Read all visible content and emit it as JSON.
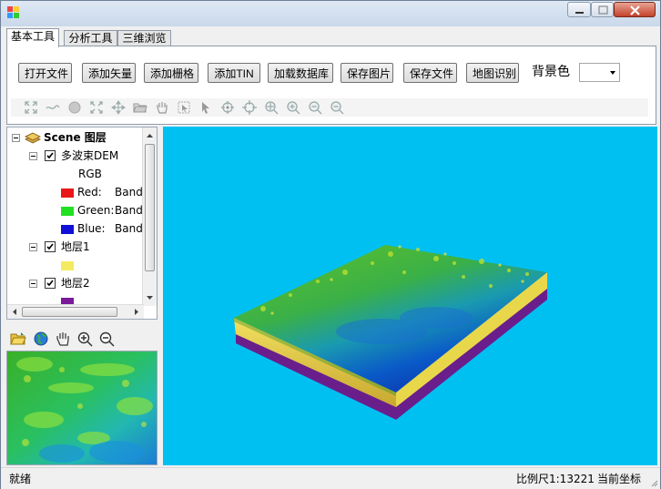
{
  "window": {
    "title": ""
  },
  "tabs": [
    {
      "label": "基本工具",
      "active": true
    },
    {
      "label": "分析工具",
      "active": false
    },
    {
      "label": "三维浏览",
      "active": false
    }
  ],
  "toolbar": {
    "buttons": [
      "打开文件",
      "添加矢量",
      "添加栅格",
      "添加TIN",
      "加载数据库",
      "保存图片",
      "保存文件",
      "地图识别"
    ],
    "background_label": "背景色",
    "background_value": ""
  },
  "map_tools": [
    "full-extent-icon",
    "measure-line-icon",
    "globe-icon",
    "fixed-zoom-icon",
    "pan-center-icon",
    "open-folder-icon",
    "pan-hand-icon",
    "select-features-icon",
    "select-arrow-icon",
    "navigate-icon",
    "fly-icon",
    "target-center-icon",
    "zoom-to-target-icon",
    "zoom-in-icon",
    "zoom-out-icon",
    "zoom-out-fixed-icon"
  ],
  "tree": {
    "root": "Scene 图层",
    "layer1": {
      "name": "多波束DEM",
      "rgb": "RGB",
      "red": {
        "label": "Red:",
        "band": "Band",
        "color": "#e81818"
      },
      "green": {
        "label": "Green:",
        "band": "Band",
        "color": "#22e022"
      },
      "blue": {
        "label": "Blue:",
        "band": "Band_",
        "color": "#1010d8"
      }
    },
    "layer2": {
      "name": "地层1",
      "color": "#f3ea62"
    },
    "layer3": {
      "name": "地层2",
      "color": "#7a1a9a"
    }
  },
  "overview_tools": [
    "open-folder-icon",
    "globe-icon",
    "pan-hand-icon",
    "zoom-in-icon",
    "zoom-out-icon"
  ],
  "colors": {
    "scene_bg": "#00c0f2",
    "top_green": "#4ec020",
    "top_blue": "#0a2fb8",
    "strata1": "#e8d74a",
    "strata2": "#6a1e8c"
  },
  "status": {
    "left": "就绪",
    "scale": "比例尺1:13221",
    "coords": "当前坐标"
  }
}
